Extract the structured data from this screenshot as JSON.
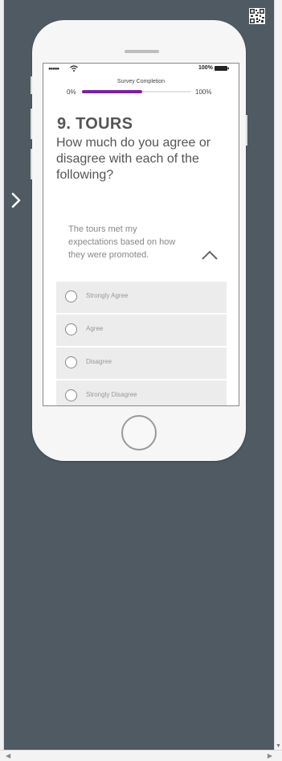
{
  "status_bar": {
    "signal": "●●●●●",
    "battery_text": "100%"
  },
  "survey": {
    "completion_label": "Survey Completion",
    "progress_start": "0%",
    "progress_end": "100%",
    "progress_fraction": 0.55,
    "accent_color": "#7d1fa8",
    "question_title": "9. TOURS",
    "question_text": "How much do you agree or disagree with each of the following?",
    "statement": "The tours met my expectations based on how they were promoted.",
    "options": [
      {
        "label": "Strongly Agree"
      },
      {
        "label": "Agree"
      },
      {
        "label": "Disagree"
      },
      {
        "label": "Strongly Disagree"
      }
    ]
  },
  "icons": {
    "qr": "qr-code-icon",
    "next": "chevron-right-icon",
    "collapse": "chevron-up-icon"
  }
}
